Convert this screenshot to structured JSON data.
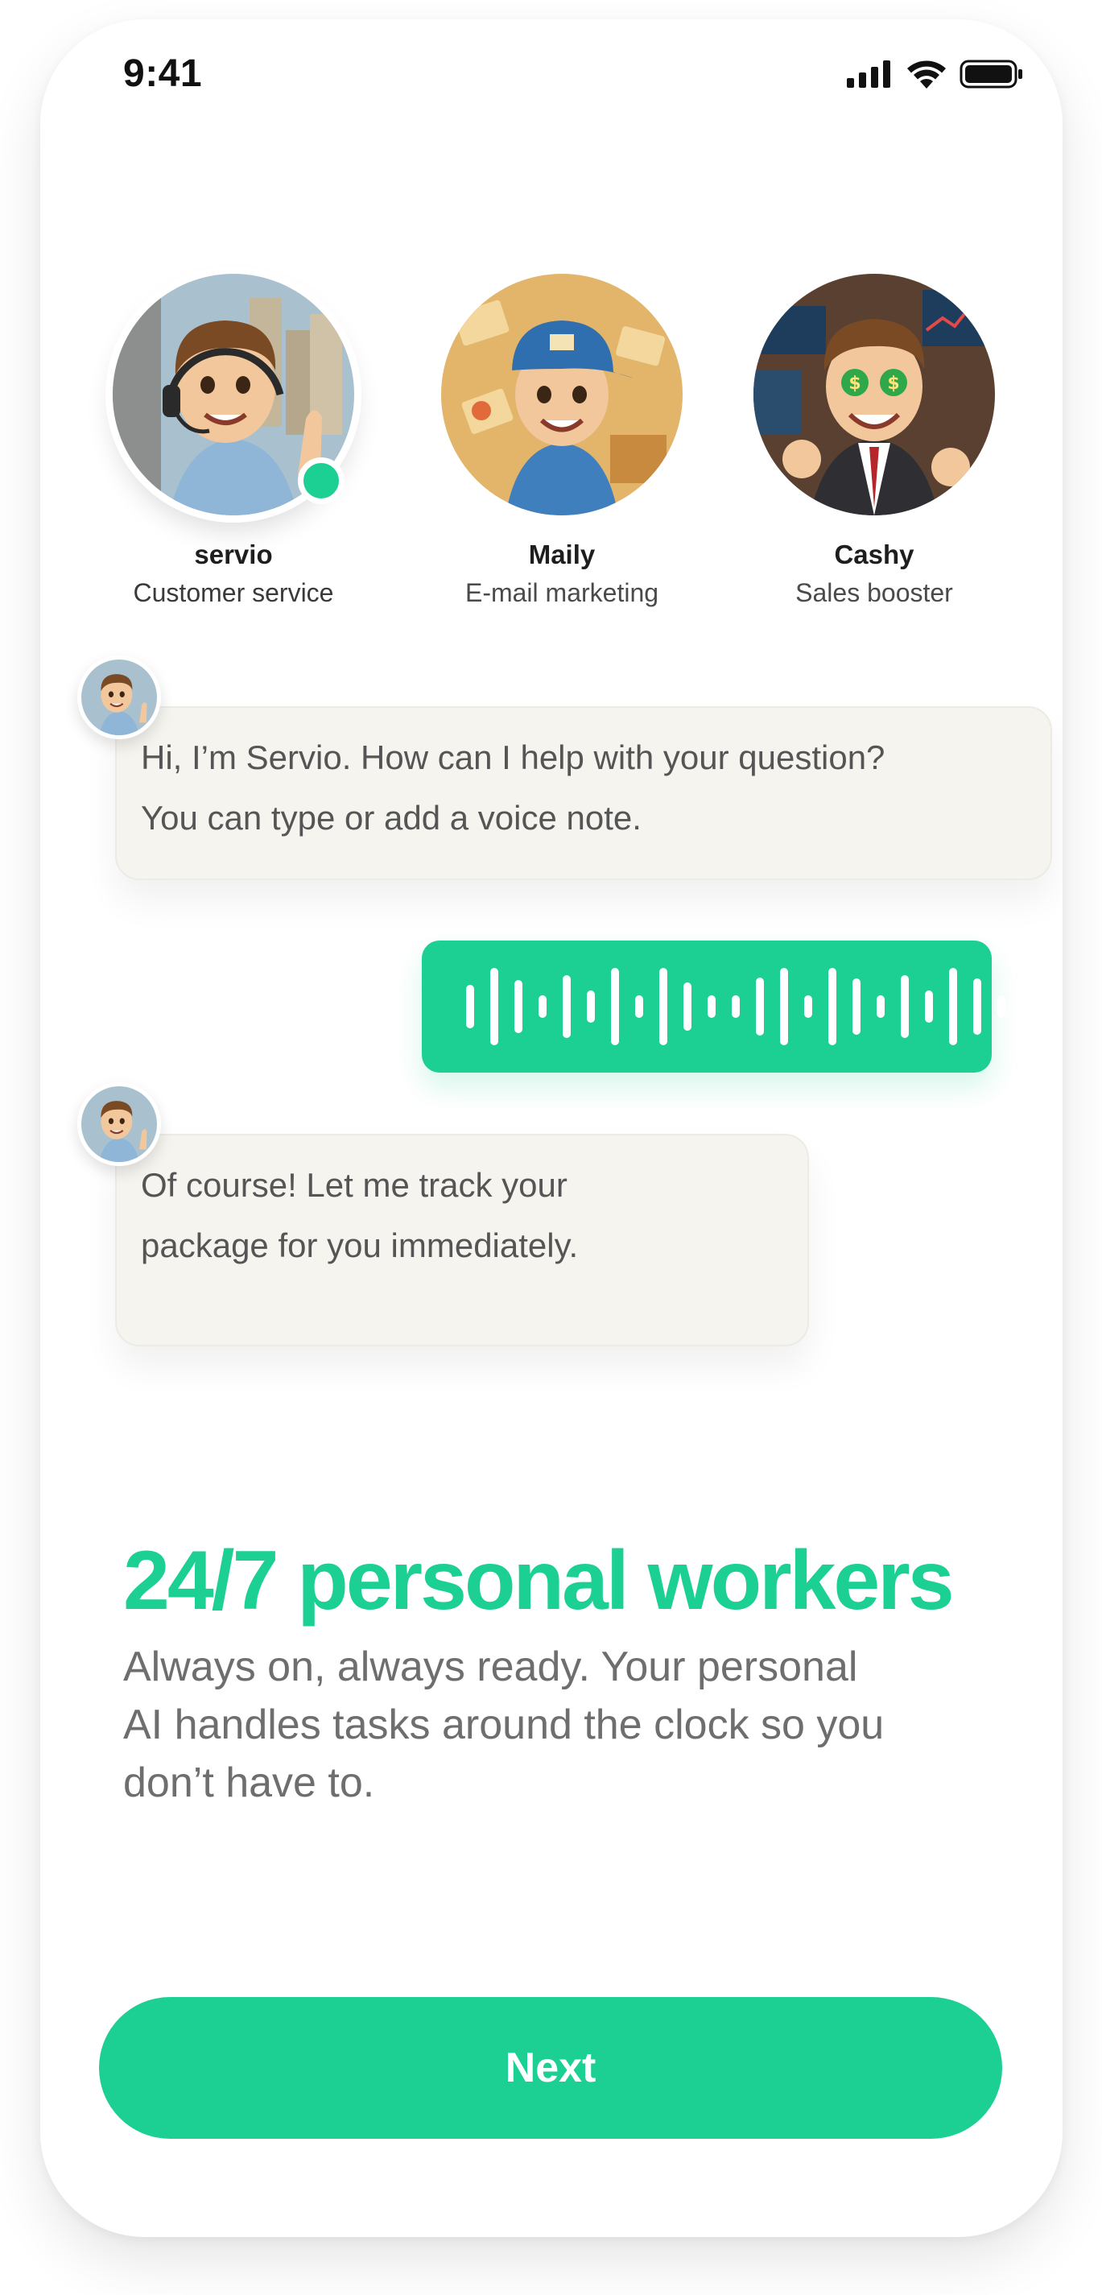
{
  "status_bar": {
    "time": "9:41",
    "icons": [
      "signal-icon",
      "wifi-icon",
      "battery-icon"
    ]
  },
  "workers": [
    {
      "name": "servio",
      "role": "Customer service",
      "online": true,
      "icon": "headset-worker-avatar"
    },
    {
      "name": "Maily",
      "role": "E-mail marketing",
      "online": false,
      "icon": "mail-courier-avatar"
    },
    {
      "name": "Cashy",
      "role": "Sales booster",
      "online": false,
      "icon": "dollar-eyes-businessman-avatar"
    }
  ],
  "chat": {
    "message_1": {
      "line1": "Hi, I’m Servio. How can I help with your question?",
      "line2": "You can type or add a voice note."
    },
    "voice_note": {
      "icon": "waveform-icon"
    },
    "message_2": {
      "line1": "Of course! Let me track your",
      "line2": "package for you immediately."
    }
  },
  "hero": {
    "headline": "24/7 personal workers",
    "line1": "Always on, always ready. Your personal",
    "line2": "AI handles tasks around the clock so you",
    "line3": "don’t have to."
  },
  "next_button": {
    "label": "Next"
  },
  "colors": {
    "accent": "#1ccf93",
    "bubble": "#f5f4ef",
    "text_muted": "#6e6e6e"
  }
}
